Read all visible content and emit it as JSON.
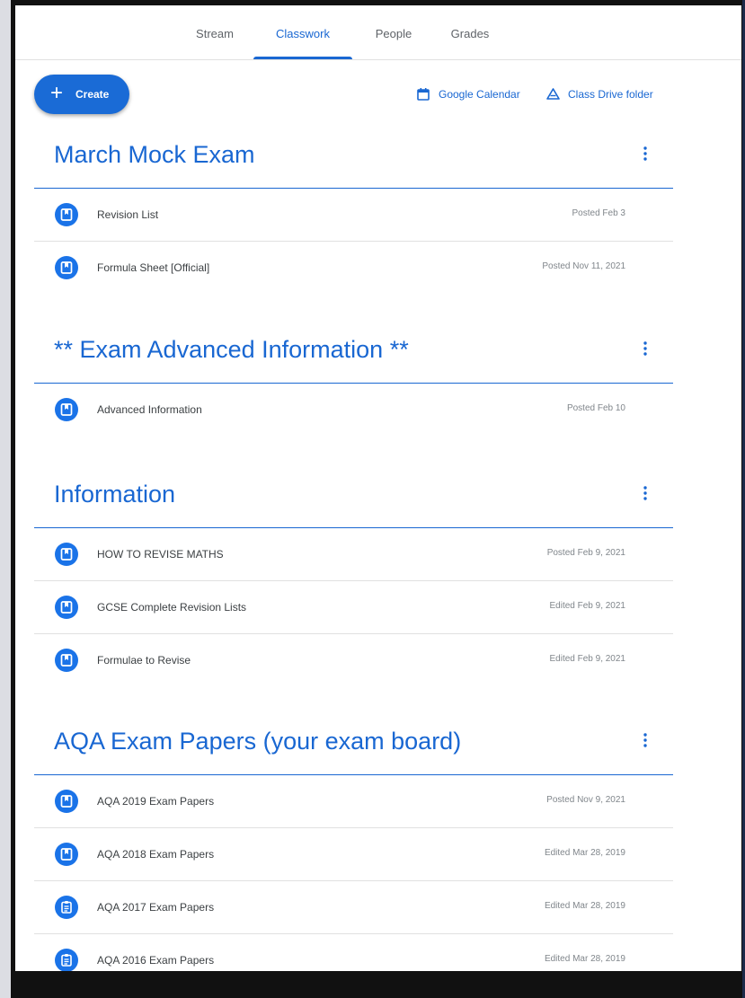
{
  "nav": {
    "tabs": [
      {
        "label": "Stream"
      },
      {
        "label": "Classwork"
      },
      {
        "label": "People"
      },
      {
        "label": "Grades"
      }
    ],
    "active": "Classwork"
  },
  "actions": {
    "create_label": "Create",
    "calendar_label": "Google Calendar",
    "drive_label": "Class Drive folder"
  },
  "colors": {
    "accent": "#1967d2",
    "icon_bg": "#1a73e8"
  },
  "topics": [
    {
      "title": "March Mock Exam",
      "items": [
        {
          "title": "Revision List",
          "date": "Posted Feb 3",
          "icon": "material-icon"
        },
        {
          "title": "Formula Sheet [Official]",
          "date": "Posted Nov 11, 2021",
          "icon": "material-icon"
        }
      ]
    },
    {
      "title": "** Exam Advanced Information **",
      "items": [
        {
          "title": "Advanced Information",
          "date": "Posted Feb 10",
          "icon": "material-icon"
        }
      ]
    },
    {
      "title": "Information",
      "items": [
        {
          "title": "HOW TO REVISE MATHS",
          "date": "Posted Feb 9, 2021",
          "icon": "material-icon"
        },
        {
          "title": "GCSE Complete Revision Lists",
          "date": "Edited Feb 9, 2021",
          "icon": "material-icon"
        },
        {
          "title": "Formulae to Revise",
          "date": "Edited Feb 9, 2021",
          "icon": "material-icon"
        }
      ]
    },
    {
      "title": "AQA Exam Papers (your exam board)",
      "items": [
        {
          "title": "AQA 2019 Exam Papers",
          "date": "Posted Nov 9, 2021",
          "icon": "material-icon"
        },
        {
          "title": "AQA 2018 Exam Papers",
          "date": "Edited Mar 28, 2019",
          "icon": "material-icon"
        },
        {
          "title": "AQA 2017 Exam Papers",
          "date": "Edited Mar 28, 2019",
          "icon": "assignment-icon"
        },
        {
          "title": "AQA 2016 Exam Papers",
          "date": "Edited Mar 28, 2019",
          "icon": "assignment-icon"
        }
      ]
    }
  ]
}
